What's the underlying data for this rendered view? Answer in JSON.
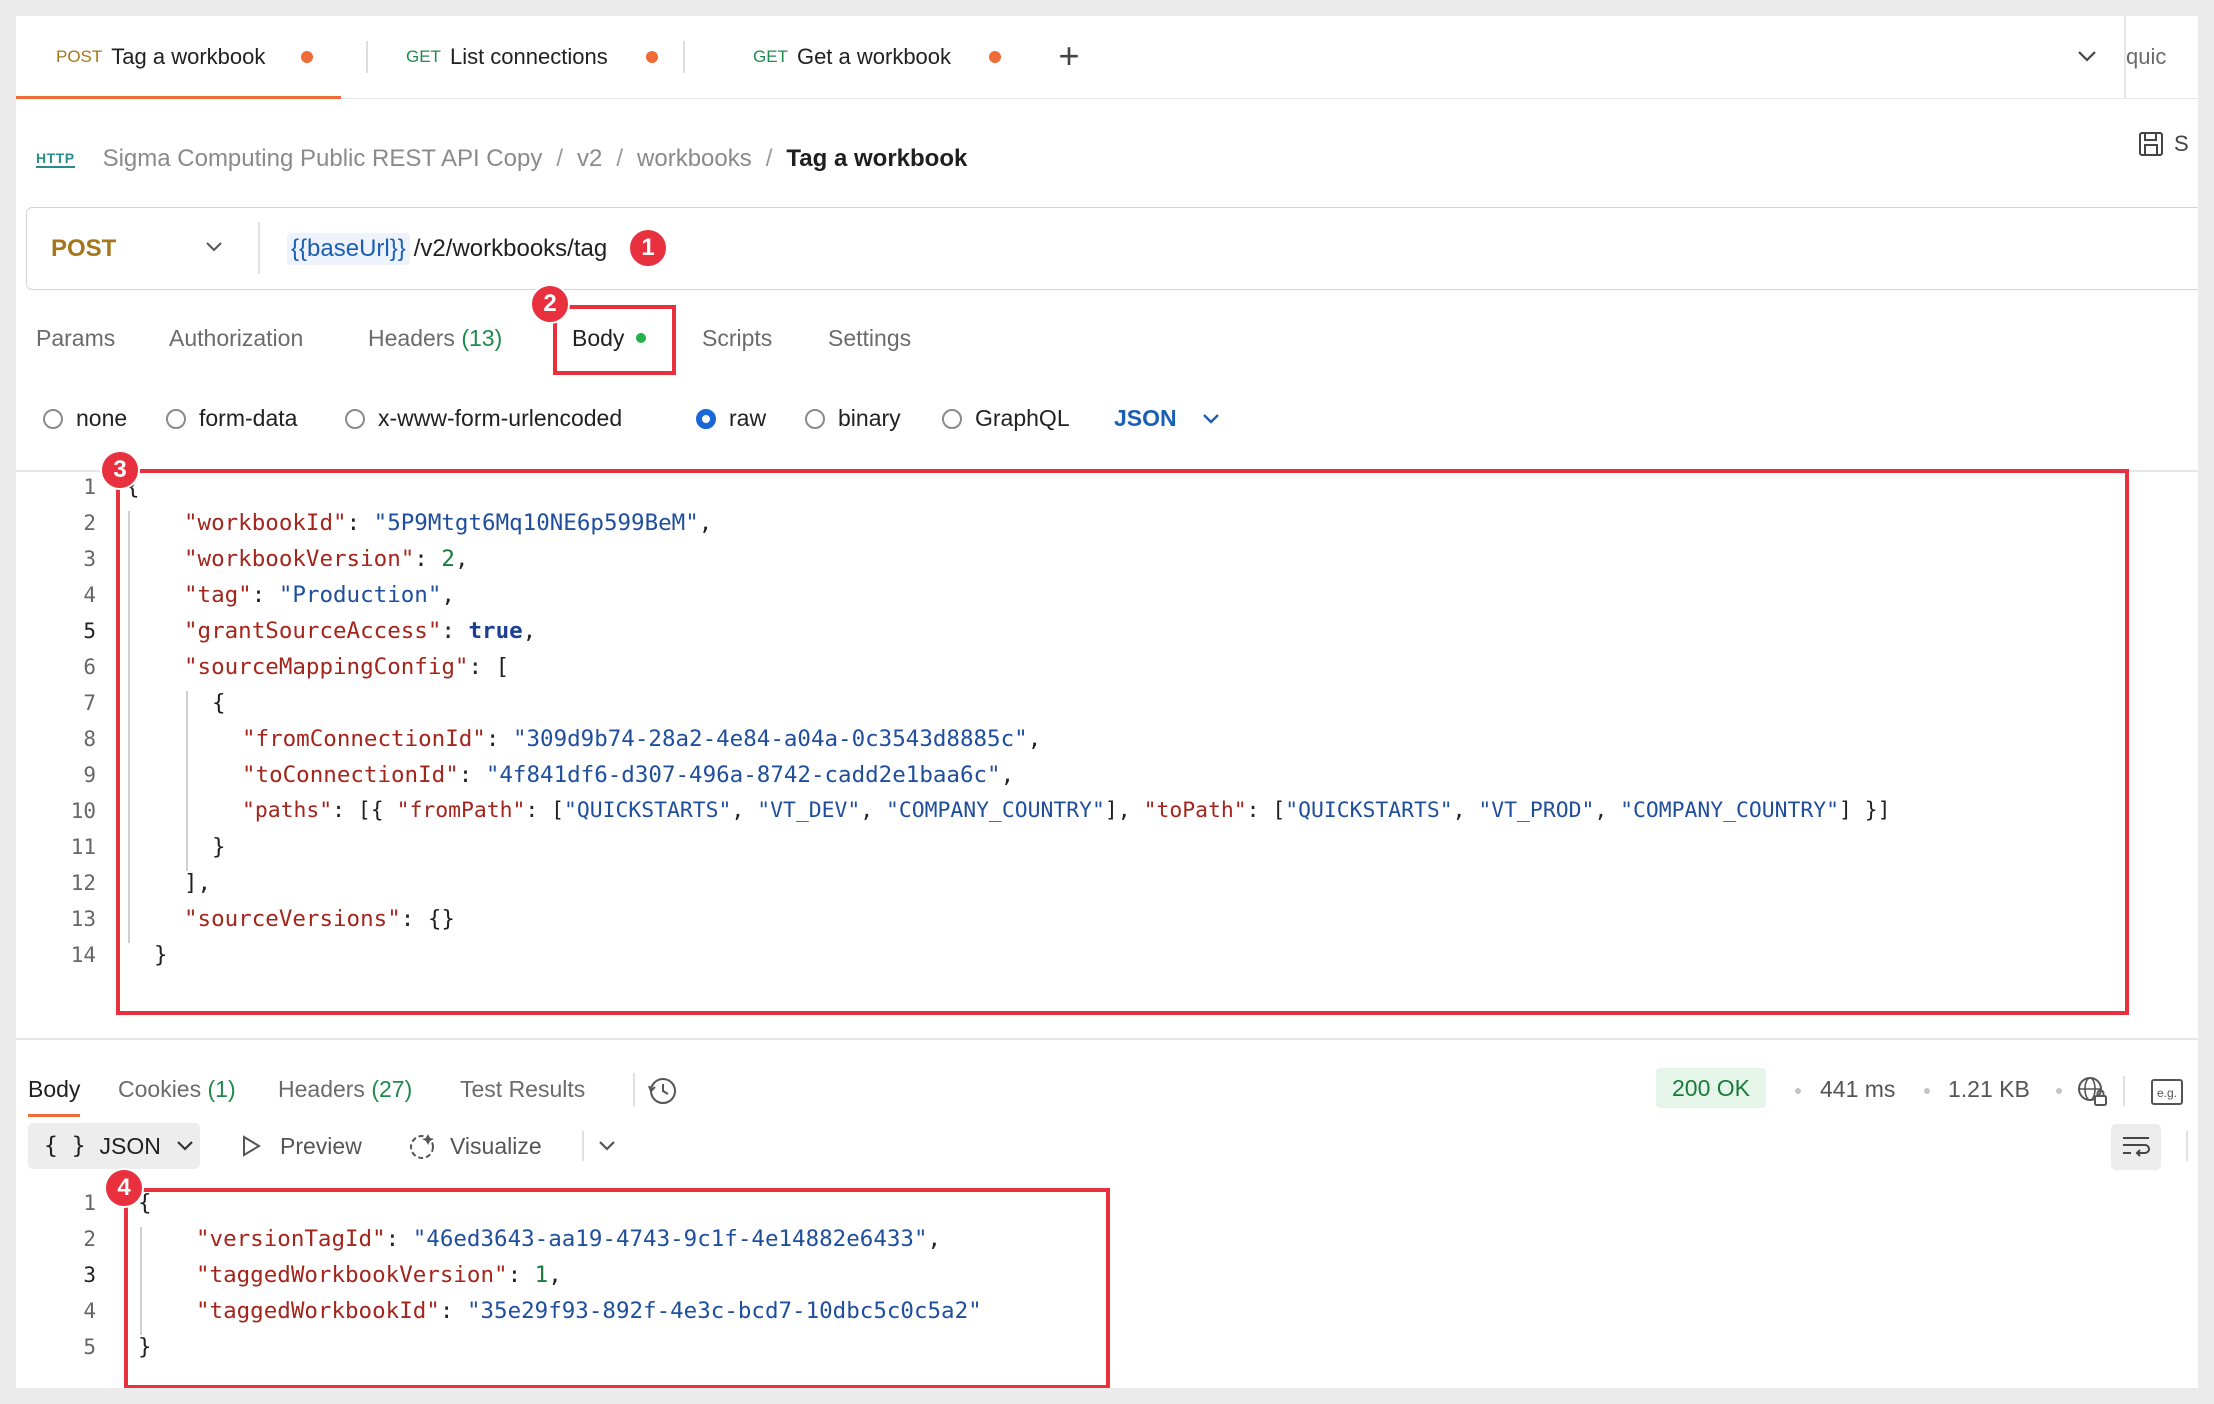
{
  "tabs": [
    {
      "method": "POST",
      "title": "Tag a workbook",
      "method_color": "#a5761b"
    },
    {
      "method": "GET",
      "title": "List connections",
      "method_color": "#1f8a4c"
    },
    {
      "method": "GET",
      "title": "Get a workbook",
      "method_color": "#1f8a4c"
    }
  ],
  "quick_label": "quic",
  "breadcrumb": {
    "protocol": "HTTP",
    "items": [
      "Sigma Computing Public REST API Copy",
      "v2",
      "workbooks"
    ],
    "current": "Tag a workbook"
  },
  "save_label": "S",
  "request": {
    "method": "POST",
    "url_variable": "{{baseUrl}}",
    "url_path": "/v2/workbooks/tag"
  },
  "request_tabs": {
    "params": "Params",
    "authorization": "Authorization",
    "headers": "Headers",
    "headers_count": "(13)",
    "body": "Body",
    "scripts": "Scripts",
    "settings": "Settings"
  },
  "body_types": {
    "options": [
      "none",
      "form-data",
      "x-www-form-urlencoded",
      "raw",
      "binary",
      "GraphQL"
    ],
    "selected": "raw",
    "format": "JSON"
  },
  "badges": [
    "1",
    "2",
    "3",
    "4"
  ],
  "request_body": {
    "line_numbers": [
      "1",
      "2",
      "3",
      "4",
      "5",
      "6",
      "7",
      "8",
      "9",
      "10",
      "11",
      "12",
      "13",
      "14"
    ],
    "brace_open": "{",
    "workbookId_key": "\"workbookId\"",
    "workbookId_value": "\"5P9Mtgt6Mq10NE6p599BeM\"",
    "workbookVersion_key": "\"workbookVersion\"",
    "workbookVersion_value": "2",
    "tag_key": "\"tag\"",
    "tag_value": "\"Production\"",
    "grantSourceAccess_key": "\"grantSourceAccess\"",
    "grantSourceAccess_value": "true",
    "sourceMappingConfig_key": "\"sourceMappingConfig\"",
    "fromConnectionId_key": "\"fromConnectionId\"",
    "fromConnectionId_value": "\"309d9b74-28a2-4e84-a04a-0c3543d8885c\"",
    "toConnectionId_key": "\"toConnectionId\"",
    "toConnectionId_value": "\"4f841df6-d307-496a-8742-cadd2e1baa6c\"",
    "paths_key": "\"paths\"",
    "fromPath_key": "\"fromPath\"",
    "toPath_key": "\"toPath\"",
    "path_values": [
      "\"QUICKSTARTS\"",
      "\"VT_DEV\"",
      "\"COMPANY_COUNTRY\"",
      "\"QUICKSTARTS\"",
      "\"VT_PROD\"",
      "\"COMPANY_COUNTRY\""
    ],
    "sourceVersions_key": "\"sourceVersions\"",
    "sourceVersions_value": "{}",
    "brace_close": "}"
  },
  "response_tabs": {
    "body": "Body",
    "cookies": "Cookies",
    "cookies_count": "(1)",
    "headers": "Headers",
    "headers_count": "(27)",
    "test_results": "Test Results"
  },
  "response_status": {
    "status": "200 OK",
    "time": "441 ms",
    "size": "1.21 KB",
    "status_color": "#1b7a3a"
  },
  "response_toolbar": {
    "format_icon": "{ }",
    "format": "JSON",
    "preview": "Preview",
    "visualize": "Visualize"
  },
  "response_body": {
    "line_numbers": [
      "1",
      "2",
      "3",
      "4",
      "5"
    ],
    "brace_open": "{",
    "versionTagId_key": "\"versionTagId\"",
    "versionTagId_value": "\"46ed3643-aa19-4743-9c1f-4e14882e6433\"",
    "taggedWorkbookVersion_key": "\"taggedWorkbookVersion\"",
    "taggedWorkbookVersion_value": "1",
    "taggedWorkbookId_key": "\"taggedWorkbookId\"",
    "taggedWorkbookId_value": "\"35e29f93-892f-4e3c-bcd7-10dbc5c0c5a2\"",
    "brace_close": "}"
  },
  "icons": [
    "http-icon",
    "chevron-down-icon",
    "plus-icon",
    "save-icon",
    "history-icon",
    "globe-lock-icon",
    "example-icon",
    "play-icon",
    "visualize-icon",
    "wrap-lines-icon"
  ]
}
